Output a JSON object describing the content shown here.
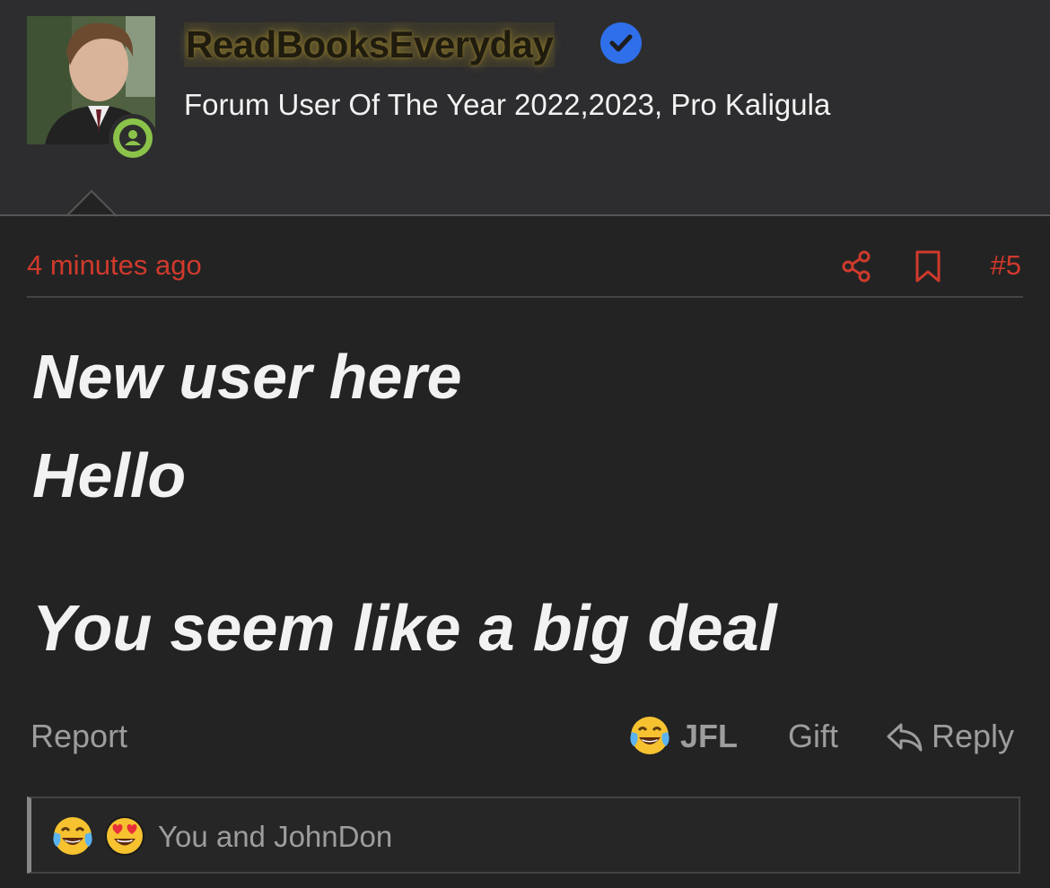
{
  "user": {
    "username": "ReadBooksEveryday",
    "verified": true,
    "title": "Forum User Of The Year 2022,2023, Pro Kaligula",
    "avatar_icon": "user-avatar-photo",
    "status_icon": "online-user-icon",
    "status_color": "#8bc34a",
    "verified_color": "#2f6fea"
  },
  "post": {
    "timestamp": "4 minutes ago",
    "post_number": "#5",
    "accent_color": "#cf3a2c",
    "body_lines": [
      "New user here",
      "Hello",
      "You seem like a big deal"
    ]
  },
  "actions": {
    "report": "Report",
    "reaction_label": "JFL",
    "reaction_icon": "tears-of-joy-emoji",
    "gift": "Gift",
    "reply": "Reply"
  },
  "reactions": {
    "icons": [
      "tears-of-joy-emoji",
      "heart-eyes-emoji"
    ],
    "text": "You and JohnDon"
  }
}
